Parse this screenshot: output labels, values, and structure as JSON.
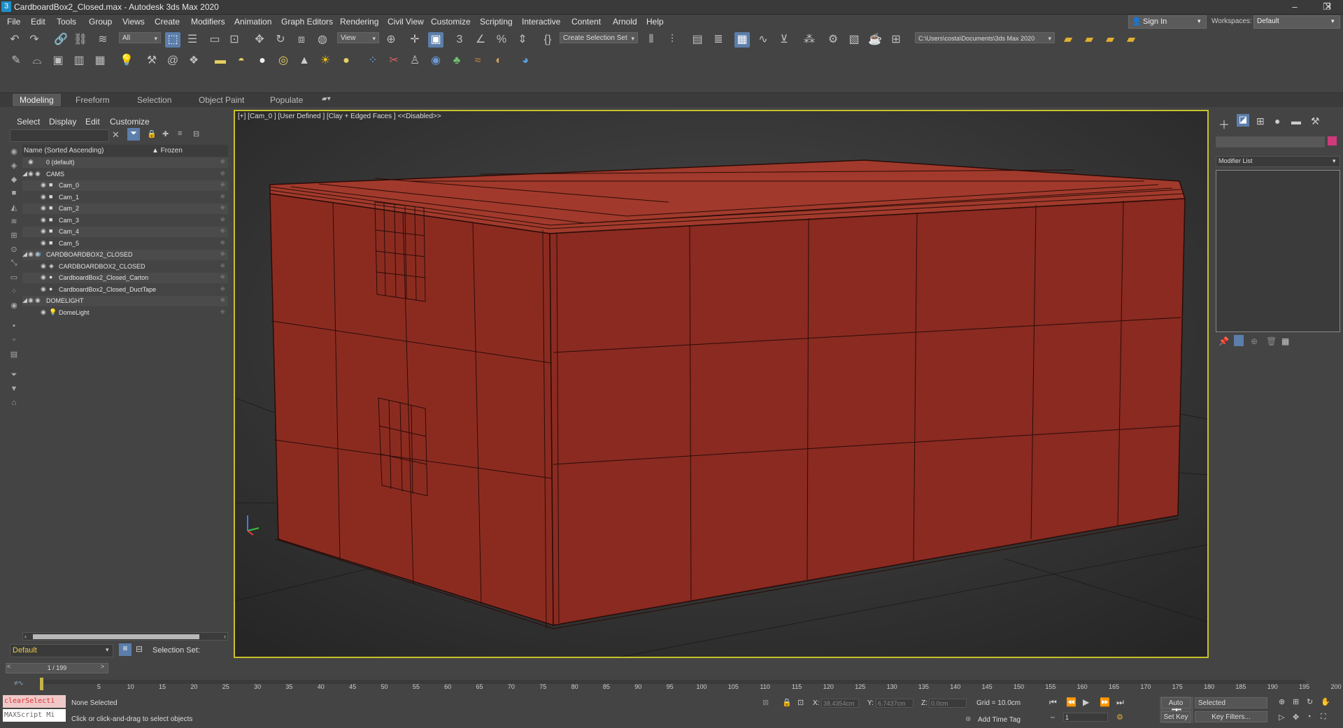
{
  "window": {
    "title": "CardboardBox2_Closed.max - Autodesk 3ds Max 2020",
    "app_icon": "3",
    "minimize": "–",
    "restore": "❐",
    "close": "✕"
  },
  "menu": [
    "File",
    "Edit",
    "Tools",
    "Group",
    "Views",
    "Create",
    "Modifiers",
    "Animation",
    "Graph Editors",
    "Rendering",
    "Civil View",
    "Customize",
    "Scripting",
    "Interactive",
    "Content",
    "Arnold",
    "Help"
  ],
  "account": {
    "sign_in": "Sign In",
    "workspaces_label": "Workspaces:",
    "workspace": "Default"
  },
  "toolbar": {
    "filter": "All",
    "ref_coord": "View",
    "selection_set": "Create Selection Set",
    "path": "C:\\Users\\costa\\Documents\\3ds Max 2020"
  },
  "ribbon": [
    "Modeling",
    "Freeform",
    "Selection",
    "Object Paint",
    "Populate"
  ],
  "scene_explorer": {
    "menus": [
      "Select",
      "Display",
      "Edit",
      "Customize"
    ],
    "header_name": "Name (Sorted Ascending)",
    "header_frozen": "▲ Frozen",
    "rows": [
      {
        "label": "0 (default)",
        "indent": 0,
        "type": "layer"
      },
      {
        "label": "CAMS",
        "indent": 0,
        "type": "layer-open"
      },
      {
        "label": "Cam_0",
        "indent": 1,
        "type": "camera"
      },
      {
        "label": "Cam_1",
        "indent": 1,
        "type": "camera"
      },
      {
        "label": "Cam_2",
        "indent": 1,
        "type": "camera"
      },
      {
        "label": "Cam_3",
        "indent": 1,
        "type": "camera"
      },
      {
        "label": "Cam_4",
        "indent": 1,
        "type": "camera"
      },
      {
        "label": "Cam_5",
        "indent": 1,
        "type": "camera"
      },
      {
        "label": "CARDBOARDBOX2_CLOSED",
        "indent": 0,
        "type": "layer-open"
      },
      {
        "label": "CARDBOARDBOX2_CLOSED",
        "indent": 1,
        "type": "group"
      },
      {
        "label": "CardboardBox2_Closed_Carton",
        "indent": 1,
        "type": "mesh"
      },
      {
        "label": "CardboardBox2_Closed_DuctTape",
        "indent": 1,
        "type": "mesh"
      },
      {
        "label": "DOMELIGHT",
        "indent": 0,
        "type": "layer-open"
      },
      {
        "label": "DomeLight",
        "indent": 1,
        "type": "light"
      }
    ],
    "layer": "Default",
    "selection_set_label": "Selection Set:"
  },
  "viewport": {
    "label": "[+] [Cam_0 ] [User Defined ] [Clay + Edged Faces ]  <<Disabled>>",
    "object_color": "#8a2a22",
    "border_color": "#c9c02c"
  },
  "command_panel": {
    "modifier_list": "Modifier List"
  },
  "timeline": {
    "frame": "1 / 199",
    "ticks": [
      "5",
      "10",
      "15",
      "20",
      "25",
      "30",
      "35",
      "40",
      "45",
      "50",
      "55",
      "60",
      "65",
      "70",
      "75",
      "80",
      "85",
      "90",
      "95",
      "100",
      "105",
      "110",
      "115",
      "120",
      "125",
      "130",
      "135",
      "140",
      "145",
      "150",
      "155",
      "160",
      "165",
      "170",
      "175",
      "180",
      "185",
      "190",
      "195",
      "200"
    ]
  },
  "status": {
    "maxscript_line1": "clearSelecti",
    "maxscript_line2": "MAXScript Mi",
    "selection": "None Selected",
    "prompt": "Click or click-and-drag to select objects",
    "x_label": "X:",
    "x_value": "38.4354cm",
    "y_label": "Y:",
    "y_value": "6.7437cm",
    "z_label": "Z:",
    "z_value": "0.0cm",
    "grid": "Grid = 10.0cm",
    "add_time_tag": "Add Time Tag",
    "auto_key": "Auto Key",
    "set_key": "Set Key",
    "key_mode": "Selected",
    "key_filters": "Key Filters...",
    "frame_field": "1"
  }
}
